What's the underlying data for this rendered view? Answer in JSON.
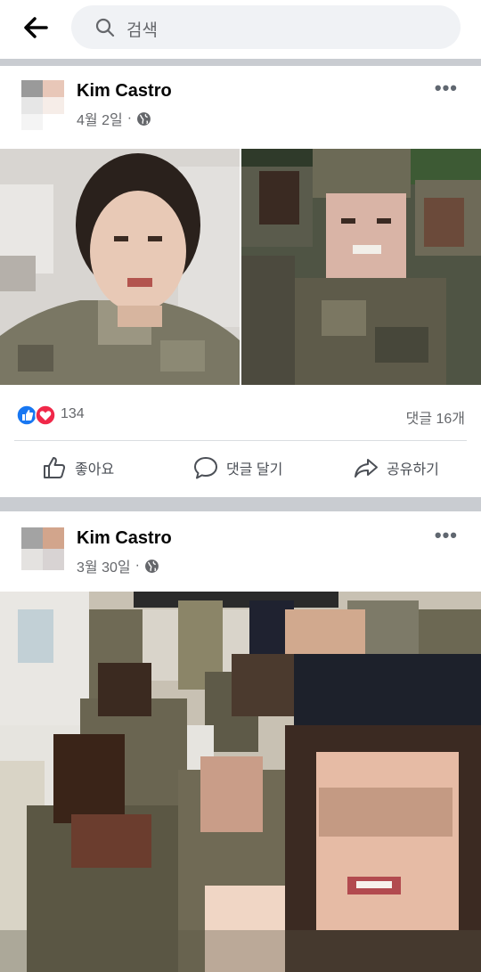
{
  "search": {
    "placeholder": "검색"
  },
  "posts": [
    {
      "author": "Kim Castro",
      "date": "4월 2일",
      "separator": "·",
      "reaction_count": "134",
      "comment_count": "댓글 16개"
    },
    {
      "author": "Kim Castro",
      "date": "3월 30일",
      "separator": "·"
    }
  ],
  "actions": {
    "like": "좋아요",
    "comment": "댓글 달기",
    "share": "공유하기"
  },
  "icons": [
    "back-arrow-icon",
    "search-icon",
    "globe-icon",
    "more-icon",
    "like-reaction-icon",
    "love-reaction-icon",
    "thumbs-up-icon",
    "comment-icon",
    "share-icon"
  ],
  "colors": {
    "like_blue": "#1877f2",
    "love_red": "#f02849",
    "divider": "#c9ccd1"
  }
}
